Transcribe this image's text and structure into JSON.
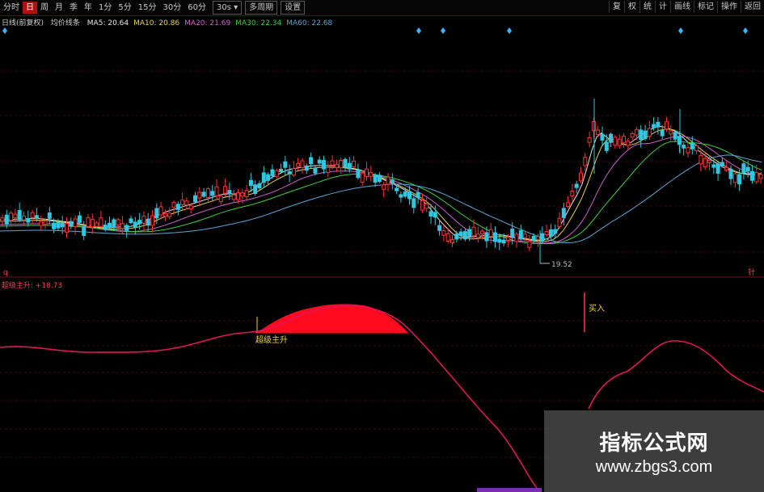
{
  "toolbar": {
    "items": [
      "分时",
      "日",
      "周",
      "月",
      "季",
      "年",
      "1分",
      "5分",
      "15分",
      "30分",
      "60分"
    ],
    "active_index": 1,
    "period_select": "30s",
    "multi_period": "多周期",
    "settings": "设置",
    "right_items": [
      "复",
      "权",
      "统",
      "计",
      "画线",
      "标记",
      "操作"
    ],
    "right_end": "返回"
  },
  "main_panel": {
    "indicator_name": "日线(前复权)",
    "indicator_type": "均价线条",
    "ma": [
      {
        "label": "MA5: 20.64",
        "color": "#e6e6e6"
      },
      {
        "label": "MA10: 20.86",
        "color": "#e8d24a"
      },
      {
        "label": "MA20: 21.69",
        "color": "#d060d0"
      },
      {
        "label": "MA30: 22.34",
        "color": "#3ecf3e"
      },
      {
        "label": "MA60: 22.68",
        "color": "#5aa7d6"
      }
    ],
    "low_price_label": "19.52",
    "left_marker": "q",
    "right_marker": "针"
  },
  "sub_panel": {
    "indicator_label": "超级主升: +18.73",
    "annotation_1": "超级主升",
    "annotation_2": "买入"
  },
  "colors": {
    "up": "#ff3030",
    "down": "#30c8e0",
    "indicator_line": "#e0165a",
    "fill": "#ff0a1e",
    "grid": "#3a0808"
  },
  "watermark": {
    "title": "指标公式网",
    "url": "www.zbgs3.com"
  }
}
